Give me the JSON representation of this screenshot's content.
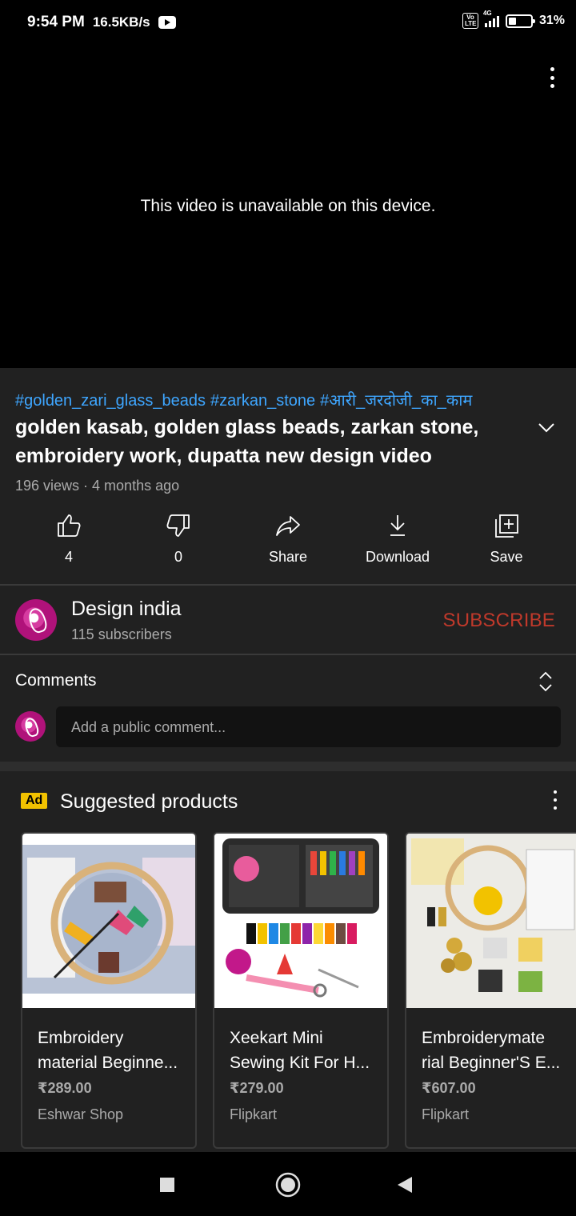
{
  "status_bar": {
    "time": "9:54 PM",
    "speed": "16.5KB/s",
    "network_badge": "Vo LTE",
    "network_type": "4G",
    "battery": "31%"
  },
  "player": {
    "message": "This video is unavailable on this device.",
    "more_icon": "more-vertical-icon"
  },
  "video": {
    "hashtags": [
      "#golden_zari_glass_beads",
      "#zarkan_stone",
      "#आरी_जरदोजी_का_काम"
    ],
    "title_line1": "golden kasab, golden glass beads, zarkan stone,",
    "title_line2": "embroidery work, dupatta new design video",
    "meta": "196 views · 4 months ago"
  },
  "actions": {
    "like": "4",
    "dislike": "0",
    "share": "Share",
    "download": "Download",
    "save": "Save"
  },
  "channel": {
    "name": "Design india",
    "subscribers": "115 subscribers",
    "subscribe_label": "SUBSCRIBE",
    "subscribe_color": "#c0392b"
  },
  "comments": {
    "title": "Comments",
    "placeholder": "Add a public comment..."
  },
  "products": {
    "ad_label": "Ad",
    "title": "Suggested products",
    "items": [
      {
        "name_line1": "Embroidery",
        "name_line2": "material Beginne...",
        "price": "₹289.00",
        "store": "Eshwar Shop"
      },
      {
        "name_line1": "Xeekart Mini",
        "name_line2": "Sewing Kit For H...",
        "price": "₹279.00",
        "store": "Flipkart"
      },
      {
        "name_line1": "Embroiderymate",
        "name_line2": "rial Beginner'S E...",
        "price": "₹607.00",
        "store": "Flipkart"
      }
    ]
  },
  "colors": {
    "background": "#212121",
    "link": "#3ea6ff",
    "ad_badge": "#f2c200"
  }
}
